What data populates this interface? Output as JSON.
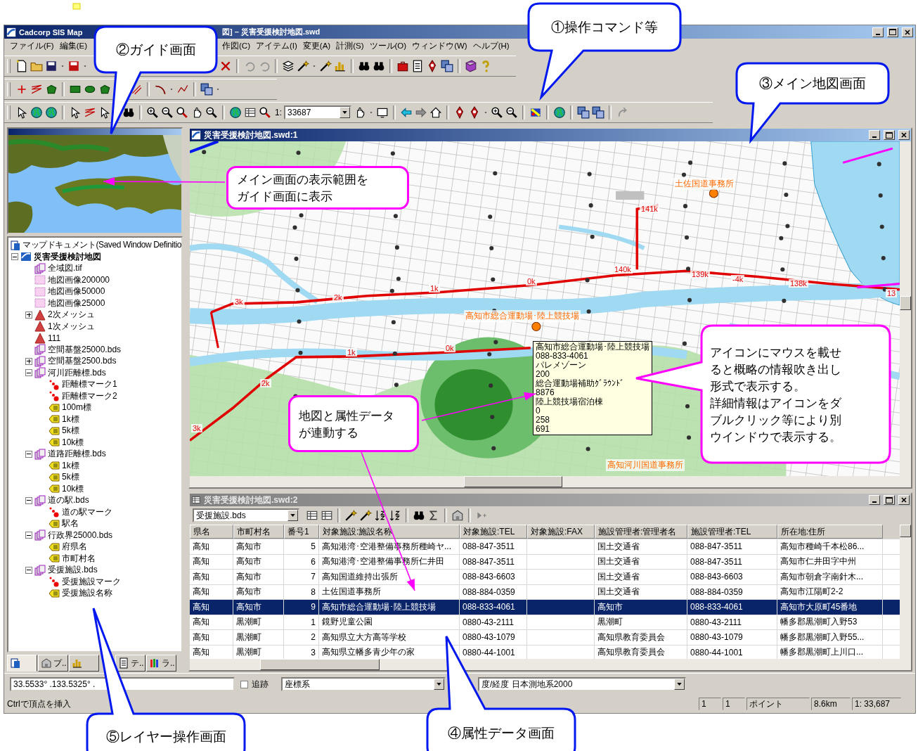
{
  "window": {
    "title_parts": [
      "Cadcorp SIS Map",
      "図] – 災害受援検討地図.swd"
    ]
  },
  "menu": [
    "ファイル(F)",
    "編集(E)",
    "作図(C)",
    "アイテム(I)",
    "変更(A)",
    "計測(S)",
    "ツール(O)",
    "ウィンドウ(W)",
    "ヘルプ(H)"
  ],
  "scale": {
    "prefix": "1:",
    "value": "33687"
  },
  "tree": {
    "header": "マップドキュメント(Saved Window Definitio",
    "items": [
      {
        "label": "災害受援検討地図",
        "kind": "doc",
        "expanded": true,
        "children": [
          {
            "label": "全域図.tif",
            "kind": "stack"
          },
          {
            "label": "地図画像200000",
            "kind": "raster"
          },
          {
            "label": "地図画像50000",
            "kind": "raster"
          },
          {
            "label": "地図画像25000",
            "kind": "raster"
          },
          {
            "label": "2次メッシュ",
            "kind": "mesh",
            "expanded": false
          },
          {
            "label": "1次メッシュ",
            "kind": "mesh"
          },
          {
            "label": "111",
            "kind": "mesh"
          },
          {
            "label": "空間基盤25000.bds",
            "kind": "stack"
          },
          {
            "label": "空間基盤2500.bds",
            "kind": "stack",
            "expanded": false
          },
          {
            "label": "河川距離標.bds",
            "kind": "stack",
            "expanded": true,
            "children": [
              {
                "label": "距離標マーク1",
                "kind": "point"
              },
              {
                "label": "距離標マーク2",
                "kind": "point"
              },
              {
                "label": "100m標",
                "kind": "tag"
              },
              {
                "label": "1k標",
                "kind": "tag"
              },
              {
                "label": "5k標",
                "kind": "tag"
              },
              {
                "label": "10k標",
                "kind": "tag"
              }
            ]
          },
          {
            "label": "道路距離標.bds",
            "kind": "stack",
            "expanded": true,
            "children": [
              {
                "label": "1k標",
                "kind": "tag"
              },
              {
                "label": "5k標",
                "kind": "tag"
              },
              {
                "label": "10k標",
                "kind": "tag"
              }
            ]
          },
          {
            "label": "道の駅.bds",
            "kind": "stack",
            "expanded": true,
            "children": [
              {
                "label": "道の駅マーク",
                "kind": "point"
              },
              {
                "label": "駅名",
                "kind": "tag"
              }
            ]
          },
          {
            "label": "行政界25000.bds",
            "kind": "stack",
            "expanded": true,
            "children": [
              {
                "label": "府県名",
                "kind": "tag"
              },
              {
                "label": "市町村名",
                "kind": "tag"
              }
            ]
          },
          {
            "label": "受援施設.bds",
            "kind": "stack",
            "expanded": true,
            "children": [
              {
                "label": "受援施設マーク",
                "kind": "point"
              },
              {
                "label": "受援施設名称",
                "kind": "tag"
              }
            ]
          }
        ]
      }
    ]
  },
  "panel_tabs": [
    {
      "selected": true
    },
    {
      "label": "プ..",
      "selected": false
    },
    {
      "selected": false
    },
    {
      "label": "テ..",
      "selected": false
    },
    {
      "label": "ラ..",
      "selected": false
    }
  ],
  "map_window": {
    "title": "災害受援検討地図.swd:1",
    "labels": [
      {
        "text": "土佐国道事務所",
        "kind": "place"
      },
      {
        "text": "141k",
        "kind": "km"
      },
      {
        "text": "140k",
        "kind": "km"
      },
      {
        "text": "139k",
        "kind": "km"
      },
      {
        "text": "-4k",
        "kind": "km"
      },
      {
        "text": "138k",
        "kind": "km"
      },
      {
        "text": "0k",
        "kind": "km"
      },
      {
        "text": "1k",
        "kind": "km"
      },
      {
        "text": "2k",
        "kind": "km"
      },
      {
        "text": "3k",
        "kind": "km"
      },
      {
        "text": "高知市総合運動場･陸上競技場",
        "kind": "place"
      },
      {
        "text": "0k",
        "kind": "km"
      },
      {
        "text": "1k",
        "kind": "km"
      },
      {
        "text": "2k",
        "kind": "km"
      },
      {
        "text": "3k",
        "kind": "km"
      },
      {
        "text": "高知河川国道事務所",
        "kind": "place"
      },
      {
        "text": "13",
        "kind": "km"
      }
    ],
    "tooltip": [
      "高知市総合運動場･陸上競技場",
      "088-833-4061",
      "パレメゾーン",
      "200",
      "総合運動場補助ｸﾞﾗｳﾝﾄﾞ",
      "8876",
      "陸上競技場宿泊棟",
      "0",
      "258",
      "691"
    ]
  },
  "table_window": {
    "title": "災害受援検討地図.swd:2",
    "layer": "受援施設.bds",
    "columns": [
      "県名",
      "市町村名",
      "番号1",
      "対象施設:施設名称",
      "対象施設:TEL",
      "対象施設:FAX",
      "施設管理者:管理者名",
      "施設管理者:TEL",
      "所在地:住所"
    ],
    "rows": [
      {
        "cells": [
          "高知",
          "高知市",
          "5",
          "高知港湾･空港整備事務所種崎ヤ...",
          "088-847-3511",
          null,
          "国土交通省",
          "088-847-3511",
          "高知市種崎千本松86..."
        ],
        "selected": false
      },
      {
        "cells": [
          "高知",
          "高知市",
          "6",
          "高知港湾･空港整備事務所仁井田",
          "088-847-3511",
          null,
          "国土交通省",
          "088-847-3511",
          "高知市仁井田字中州"
        ],
        "selected": false
      },
      {
        "cells": [
          "高知",
          "高知市",
          "7",
          "高知国道維持出張所",
          "088-843-6603",
          null,
          "国土交通省",
          "088-843-6603",
          "高知市朝倉字南針木..."
        ],
        "selected": false
      },
      {
        "cells": [
          "高知",
          "高知市",
          "8",
          "土佐国道事務所",
          "088-884-0359",
          null,
          "国土交通省",
          "088-884-0359",
          "高知市江陽町2-2"
        ],
        "selected": false
      },
      {
        "cells": [
          "高知",
          "高知市",
          "9",
          "高知市総合運動場･陸上競技場",
          "088-833-4061",
          null,
          "高知市",
          "088-833-4061",
          "高知市大原町45番地"
        ],
        "selected": true
      },
      {
        "cells": [
          "高知",
          "黒潮町",
          "1",
          "鏡野児童公園",
          "0880-43-2111",
          null,
          "黒潮町",
          "0880-43-2111",
          "幡多郡黒潮町入野53"
        ],
        "selected": false
      },
      {
        "cells": [
          "高知",
          "黒潮町",
          "2",
          "高知県立大方高等学校",
          "0880-43-1079",
          null,
          "高知県教育委員会",
          "0880-43-1079",
          "幡多郡黒潮町入野55..."
        ],
        "selected": false
      },
      {
        "cells": [
          "高知",
          "黒潮町",
          "3",
          "高知県立幡多青少年の家",
          "0880-44-1001",
          null,
          "高知県教育委員会",
          "0880-44-1001",
          "幡多郡黒潮町上川口..."
        ],
        "selected": false
      }
    ]
  },
  "coords": {
    "value": "33.5533° .133.5325° .",
    "trace": {
      "label": "追跡",
      "checked": false
    },
    "crs_label": "座標系",
    "crs": "度/経度 日本測地系2000"
  },
  "status_bar": {
    "message": "Ctrlで頂点を挿入",
    "panes": [
      "1",
      "1",
      "ポイント",
      "8.6km",
      "1: 33,687"
    ]
  },
  "callouts": [
    {
      "kind": "blue",
      "lines": [
        "①操作コマンド等"
      ]
    },
    {
      "kind": "blue",
      "lines": [
        "②ガイド画面"
      ]
    },
    {
      "kind": "blue",
      "lines": [
        "③メイン地図画面"
      ]
    },
    {
      "kind": "pink",
      "lines": [
        "メイン画面の表示範囲を",
        "ガイド画面に表示"
      ]
    },
    {
      "kind": "pink",
      "lines": [
        "地図と属性データ",
        "が連動する"
      ]
    },
    {
      "kind": "pink",
      "lines": [
        "アイコンにマウスを載せ",
        "ると概略の情報吹き出し",
        "形式で表示する。",
        "詳細情報はアイコンをダ",
        "ブルクリック等により別",
        "ウインドウで表示する。"
      ]
    },
    {
      "kind": "blue",
      "lines": [
        "⑤レイヤー操作画面"
      ]
    },
    {
      "kind": "blue",
      "lines": [
        "④属性データ画面"
      ]
    }
  ]
}
